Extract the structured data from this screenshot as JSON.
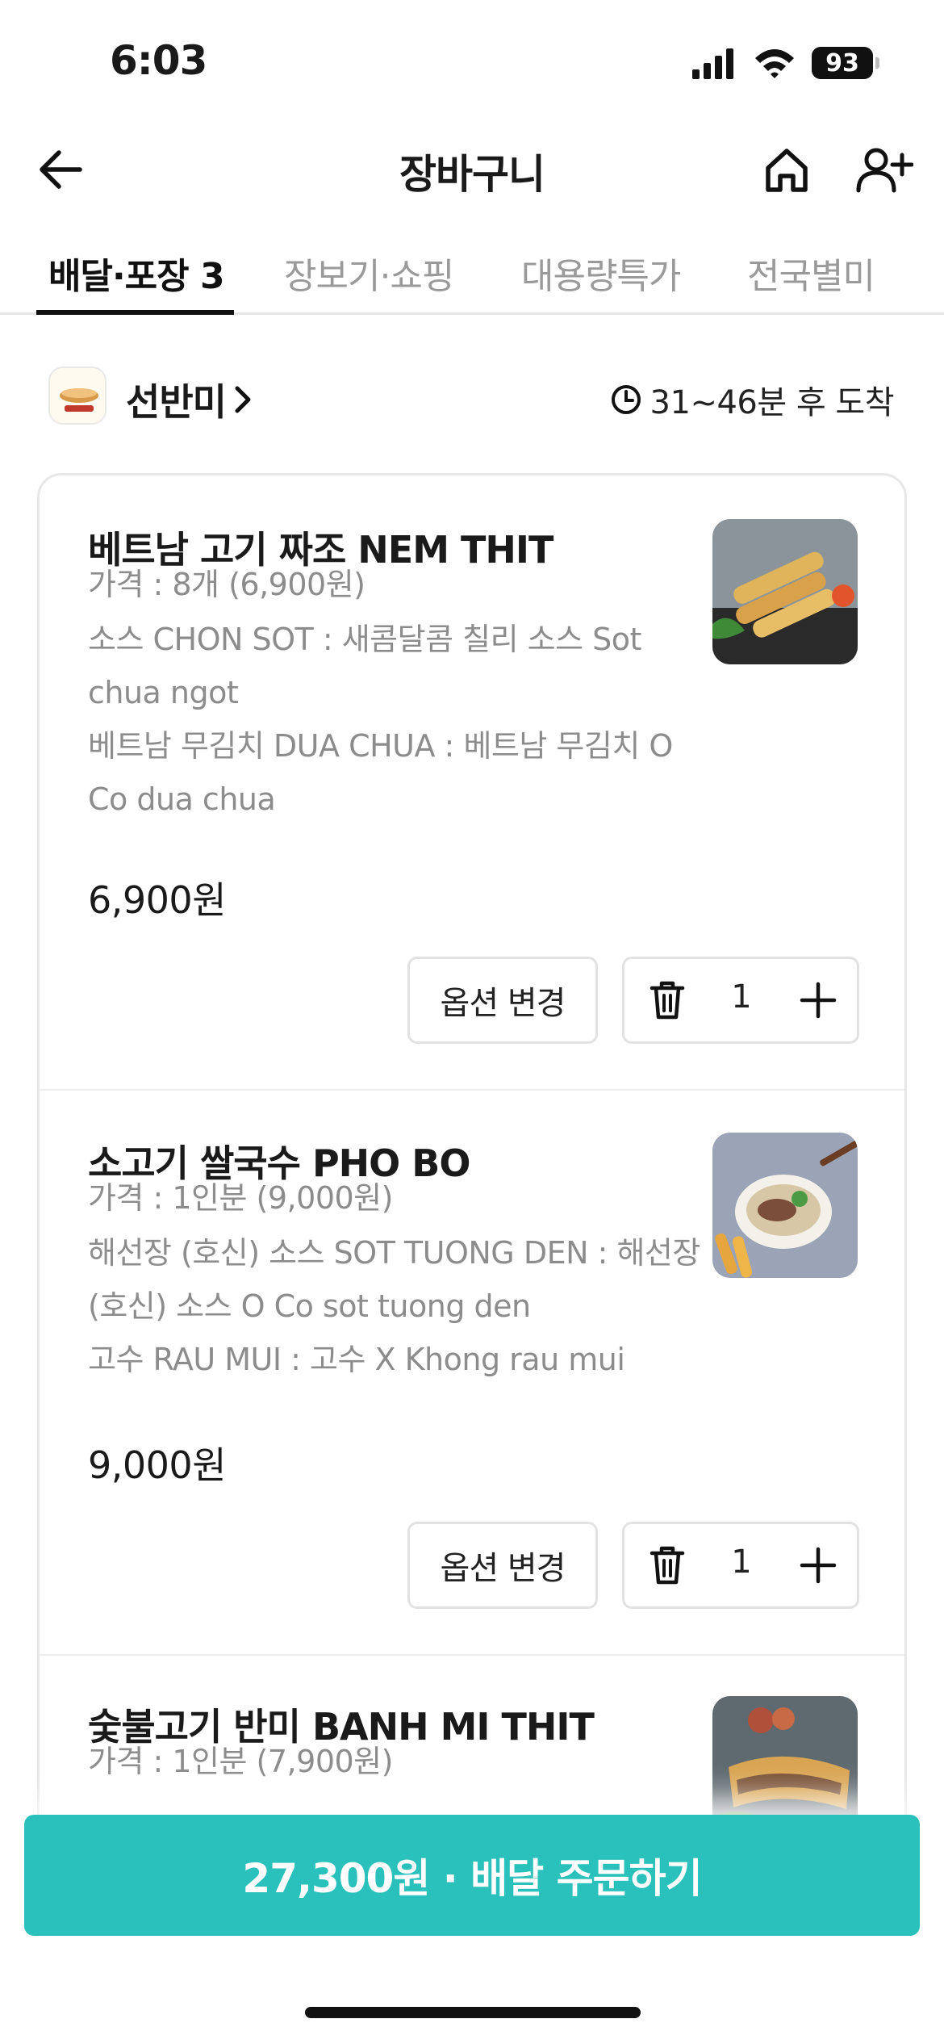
{
  "status_bar": {
    "time": "6:03",
    "battery": "93"
  },
  "header": {
    "title": "장바구니"
  },
  "tabs": [
    {
      "label": "배달·포장 3",
      "active": true
    },
    {
      "label": "장보기·쇼핑",
      "active": false
    },
    {
      "label": "대용량특가",
      "active": false
    },
    {
      "label": "전국별미",
      "active": false
    }
  ],
  "store": {
    "name": "선반미",
    "eta": "31~46분 후 도착"
  },
  "items": [
    {
      "title": "베트남 고기 짜조 NEM THIT",
      "lines": [
        "가격 : 8개 (6,900원)",
        "소스 CHON SOT : 새콤달콤 칠리 소스 Sot chua ngot",
        "베트남 무김치 DUA CHUA : 베트남 무김치 O Co dua chua"
      ],
      "price": "6,900원",
      "option_label": "옵션 변경",
      "quantity": "1",
      "image": "spring-rolls"
    },
    {
      "title": "소고기 쌀국수 PHO BO",
      "lines": [
        "가격 : 1인분 (9,000원)",
        "해선장 (호신) 소스 SOT TUONG DEN : 해선장 (호신) 소스 O Co sot tuong den",
        "고수 RAU MUI : 고수 X Khong rau mui"
      ],
      "price": "9,000원",
      "option_label": "옵션 변경",
      "quantity": "1",
      "image": "pho-bowl"
    },
    {
      "title": "숯불고기 반미 BANH MI THIT",
      "lines": [
        "가격 : 1인분 (7,900원)"
      ],
      "image": "banh-mi"
    }
  ],
  "order_button": {
    "label": "27,300원 · 배달 주문하기"
  },
  "colors": {
    "accent": "#2ac1bc",
    "muted_text": "#8c8c8c"
  }
}
